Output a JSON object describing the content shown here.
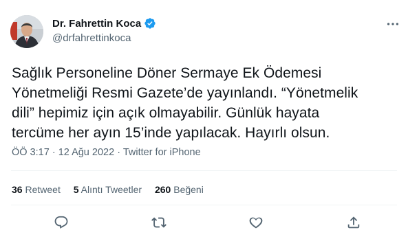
{
  "user": {
    "display_name": "Dr. Fahrettin Koca",
    "handle": "@drfahrettinkoca",
    "verified": true
  },
  "tweet": {
    "lines": [
      "Sağlık Personeline Döner Sermaye Ek Ödemesi",
      "Yönetmeliği Resmi Gazete’de yayınlandı. “Yönetmelik",
      "dili” hepimiz için açık olmayabilir. Günlük hayata",
      "tercüme her ayın 15’inde yapılacak. Hayırlı olsun."
    ],
    "time": "ÖÖ 3:17",
    "separator": "·",
    "date": "12 Ağu 2022",
    "source": "Twitter for iPhone"
  },
  "stats": [
    {
      "count": "36",
      "label": "Retweet"
    },
    {
      "count": "5",
      "label": "Alıntı Tweetler"
    },
    {
      "count": "260",
      "label": "Beğeni"
    }
  ],
  "icons": {
    "more": "more-icon",
    "verified": "verified-badge-icon",
    "reply": "reply-icon",
    "retweet": "retweet-icon",
    "like": "like-icon",
    "share": "share-icon"
  },
  "colors": {
    "text": "#0f1419",
    "secondary": "#536471",
    "verified": "#1d9bf0",
    "divider": "#eff3f4"
  }
}
